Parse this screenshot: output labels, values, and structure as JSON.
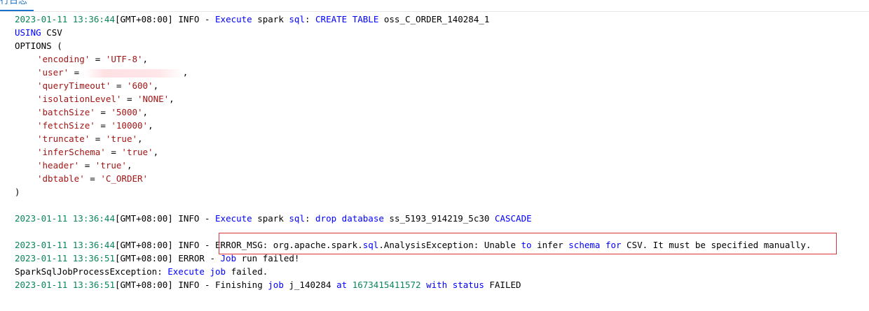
{
  "tab": {
    "label": "行日志"
  },
  "log": {
    "l1": {
      "ts": "2023-01-11 13:36:44",
      "tz": "[GMT+08:00]",
      "level": " INFO - ",
      "w1": "Execute",
      "w2": " spark ",
      "w3": "sql",
      "w4": ": ",
      "w5": "CREATE",
      "w6": " ",
      "w7": "TABLE",
      "w8": " oss_C_ORDER_140284_1"
    },
    "l2": {
      "w1": "USING",
      "w2": " CSV"
    },
    "l3": {
      "w1": "OPTIONS ("
    },
    "options": [
      {
        "key": "'encoding'",
        "eq": " = ",
        "val": "'UTF-8'",
        "end": ","
      },
      {
        "key": "'user'",
        "eq": " = ",
        "val": "",
        "end": ","
      },
      {
        "key": "'queryTimeout'",
        "eq": " = ",
        "val": "'600'",
        "end": ","
      },
      {
        "key": "'isolationLevel'",
        "eq": " = ",
        "val": "'NONE'",
        "end": ","
      },
      {
        "key": "'batchSize'",
        "eq": " = ",
        "val": "'5000'",
        "end": ","
      },
      {
        "key": "'fetchSize'",
        "eq": " = ",
        "val": "'10000'",
        "end": ","
      },
      {
        "key": "'truncate'",
        "eq": " = ",
        "val": "'true'",
        "end": ","
      },
      {
        "key": "'inferSchema'",
        "eq": " = ",
        "val": "'true'",
        "end": ","
      },
      {
        "key": "'header'",
        "eq": " = ",
        "val": "'true'",
        "end": ","
      },
      {
        "key": "'dbtable'",
        "eq": " = ",
        "val": "'C_ORDER'",
        "end": ""
      }
    ],
    "close_paren": ")",
    "l15": {
      "ts": "2023-01-11 13:36:44",
      "tz": "[GMT+08:00]",
      "level": " INFO - ",
      "w1": "Execute",
      "w2": " spark ",
      "w3": "sql",
      "w4": ": ",
      "w5": "drop",
      "w6": " ",
      "w7": "database",
      "w8": " ss_5193_914219_5c30 ",
      "w9": "CASCADE"
    },
    "l17": {
      "ts": "2023-01-11 13:36:44",
      "tz": "[GMT+08:00]",
      "level": " INFO - ",
      "w1": "ERROR_MSG: org.apache.spark.",
      "w2": "sql",
      "w3": ".AnalysisException: Unable ",
      "w4": "to",
      "w5": " infer ",
      "w6": "schema",
      "w7": " ",
      "w8": "for",
      "w9": " CSV. It must be specified manually."
    },
    "l18": {
      "ts": "2023-01-11 13:36:51",
      "tz": "[GMT+08:00]",
      "level": " ERROR - ",
      "w1": "Job",
      "w2": " run failed!"
    },
    "l19": {
      "w1": "SparkSqlJobProcessException: ",
      "w2": "Execute",
      "w3": " ",
      "w4": "job",
      "w5": " failed."
    },
    "l20": {
      "ts": "2023-01-11 13:36:51",
      "tz": "[GMT+08:00]",
      "level": " INFO - Finishing ",
      "w1": "job",
      "w2": " j_140284 ",
      "w3": "at",
      "w4": " 1673415411572 ",
      "w5": "with",
      "w6": " ",
      "w7": "status",
      "w8": " FAILED"
    }
  },
  "colors": {
    "timestamp": "#098658",
    "keyword": "#0000ff",
    "string": "#a31515",
    "tab_accent": "#1a73c8",
    "error_box": "#d9363e"
  }
}
